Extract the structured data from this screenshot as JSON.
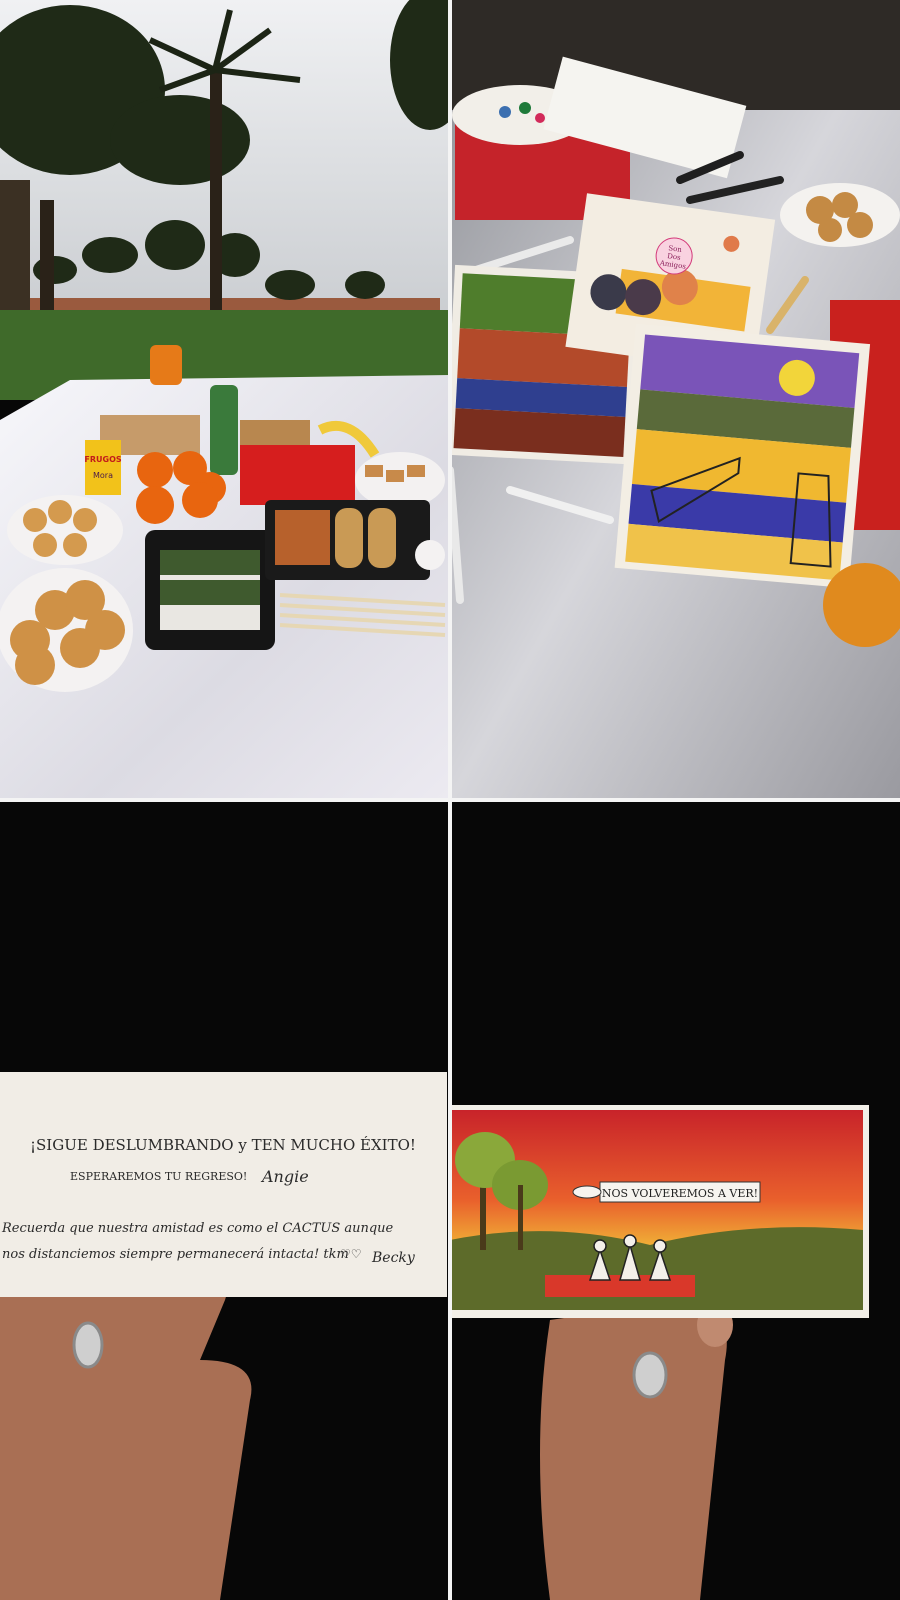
{
  "collage": {
    "panels": [
      {
        "subject": "picnic-spread"
      },
      {
        "subject": "drawings-on-blanket"
      },
      {
        "subject": "handwritten-note"
      },
      {
        "subject": "painted-card"
      }
    ]
  },
  "photo1": {
    "juice_box_brand": "Frugos Mora",
    "juice_brand_short": "FRUGOS",
    "juice_flavor": "Mora"
  },
  "photo2": {
    "drawing_caption_lines": [
      "Son",
      "Dos",
      "Amigos"
    ]
  },
  "note": {
    "line1": "¡SIGUE DESLUMBRANDO y TEN MUCHO ÉXITO!",
    "line2": "ESPERAREMOS TU REGRESO!",
    "signature1": "Angie",
    "line3": "Recuerda que nuestra amistad es como el CACTUS aunque",
    "line4": "nos distanciemos siempre permanecerá intacta! tkm",
    "hearts": "♡♡",
    "signature2": "Becky"
  },
  "card": {
    "banner_text": "NOS VOLVEREMOS A VER!"
  },
  "colors": {
    "sky": "#c9ccd0",
    "grass": "#3f6a2a",
    "blanket": "#ecebf0",
    "dark_background": "#070707",
    "paper": "#f1ede6",
    "sunset_red": "#d93a2a",
    "sunset_yellow": "#f2c73a"
  }
}
